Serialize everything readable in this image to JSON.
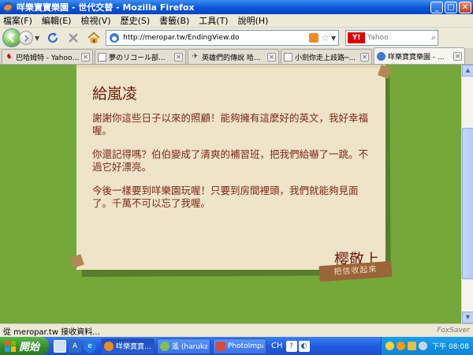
{
  "window": {
    "title": "咩樂寶寶樂園 - 世代交替 - Mozilla Firefox"
  },
  "menu": [
    "檔案(F)",
    "編輯(E)",
    "檢視(V)",
    "歷史(S)",
    "書籤(B)",
    "工具(T)",
    "說明(H)"
  ],
  "nav": {
    "url": "http://meropar.tw/EndingView.do",
    "search_placeholder": "Yahoo"
  },
  "tabs": [
    {
      "label": "巴哈姆特 - Yahoo!...",
      "active": false
    },
    {
      "label": "夢のリコール部...",
      "active": false
    },
    {
      "label": "英雄們的傳說 哈...",
      "active": false
    },
    {
      "label": "小劍你走上歧路─...",
      "active": false
    },
    {
      "label": "咩樂寶寶樂園 - ...",
      "active": true
    }
  ],
  "letter": {
    "greeting": "給嵐凌",
    "paragraphs": [
      "謝謝你這些日子以來的照顧！能夠擁有這麼好的英文，我好幸福喔。",
      "你還記得嗎？伯伯變成了清爽的補習班，把我們給嚇了一跳。不過它好漂亮。",
      "今後一樣要到咩樂園玩喔！只要到房間裡頭，我們就能夠見面了。千萬不可以忘了我喔。"
    ],
    "signature": "樱敬上",
    "stamp": "把信收起來"
  },
  "status": {
    "text": "從 meropar.tw 接收資料...",
    "addon": "FoxSaver"
  },
  "taskbar": {
    "start_label": "開始",
    "buttons": [
      {
        "label": "咩樂寶寶...",
        "active": true
      },
      {
        "label": "遙 (haruka_...",
        "active": false
      },
      {
        "label": "PhotoImpac...",
        "active": false
      }
    ],
    "lang": "CH",
    "clock": "下午 08:08"
  }
}
